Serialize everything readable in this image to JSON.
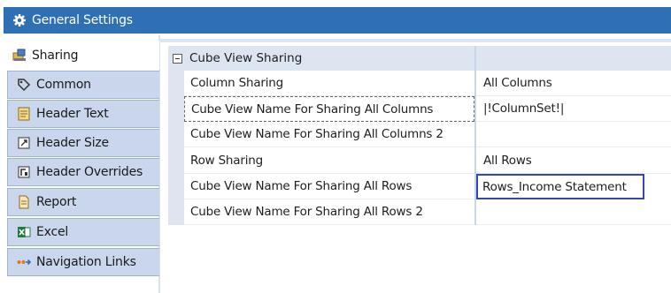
{
  "window": {
    "title": "General Settings",
    "icon": "gear-icon"
  },
  "sidebar": {
    "items": [
      {
        "label": "Sharing",
        "icon": "sharing-icon",
        "active": true
      },
      {
        "label": "Common",
        "icon": "tag-icon",
        "active": false
      },
      {
        "label": "Header Text",
        "icon": "header-text-icon",
        "active": false
      },
      {
        "label": "Header Size",
        "icon": "header-size-icon",
        "active": false
      },
      {
        "label": "Header Overrides",
        "icon": "header-overrides-icon",
        "active": false
      },
      {
        "label": "Report",
        "icon": "report-icon",
        "active": false
      },
      {
        "label": "Excel",
        "icon": "excel-icon",
        "active": false
      },
      {
        "label": "Navigation Links",
        "icon": "navigation-links-icon",
        "active": false
      }
    ]
  },
  "grid": {
    "category": "Cube View Sharing",
    "rows": [
      {
        "name": "Column Sharing",
        "value": "All Columns"
      },
      {
        "name": "Cube View Name For Sharing All Columns",
        "value": "|!ColumnSet!|"
      },
      {
        "name": "Cube View Name For Sharing All Columns 2",
        "value": ""
      },
      {
        "name": "Row Sharing",
        "value": "All Rows"
      },
      {
        "name": "Cube View Name For Sharing All Rows",
        "value": "Rows_Income Statement"
      },
      {
        "name": "Cube View Name For Sharing All Rows 2",
        "value": ""
      }
    ]
  },
  "colors": {
    "title_bar": "#2f6fb3",
    "sidebar_tab": "#c9d6ec",
    "grid_band": "#dde5f1",
    "edit_border": "#3a45b5"
  }
}
